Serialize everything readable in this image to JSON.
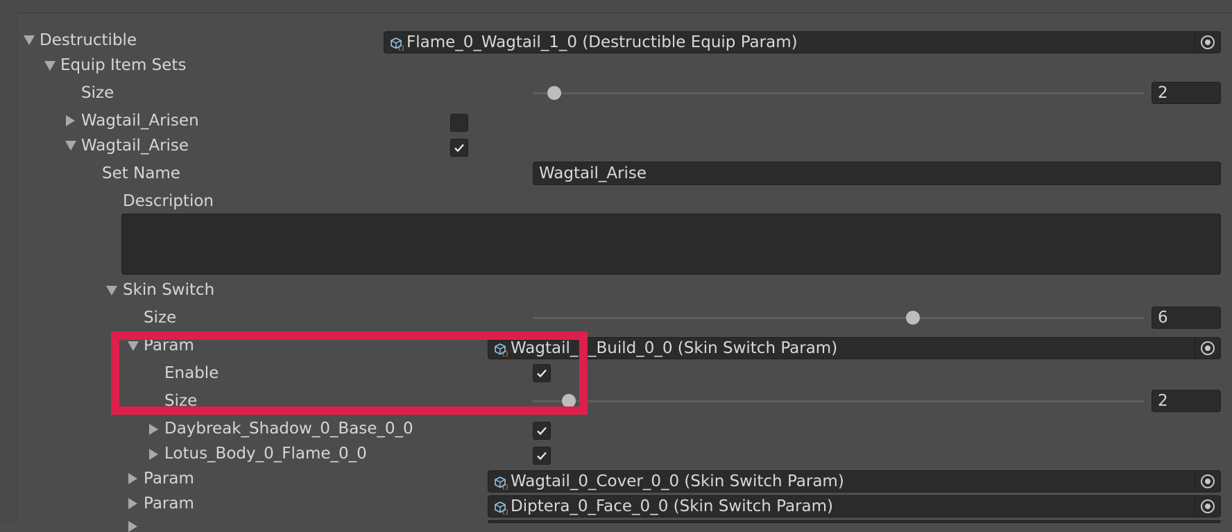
{
  "colors": {
    "highlight": "#dd1f4c",
    "field_bg": "#2b2b2b",
    "panel_bg": "#4c4c4c"
  },
  "tree": {
    "destructible": {
      "label": "Destructible",
      "object": "Flame_0_Wagtail_1_0 (Destructible Equip Param)"
    },
    "equip_item_sets": {
      "label": "Equip Item Sets",
      "size_label": "Size",
      "size_value": "2",
      "size_slider_fraction": 0.036
    },
    "wagtail_arisen": {
      "label": "Wagtail_Arisen",
      "checked": false
    },
    "wagtail_arise": {
      "label": "Wagtail_Arise",
      "checked": true,
      "set_name_label": "Set Name",
      "set_name_value": "Wagtail_Arise",
      "description_label": "Description",
      "description_value": ""
    },
    "skin_switch": {
      "label": "Skin Switch",
      "size_label": "Size",
      "size_value": "6",
      "size_slider_fraction": 0.62
    },
    "param_open": {
      "label": "Param",
      "object": "Wagtail_0_Build_0_0 (Skin Switch Param)",
      "enable_label": "Enable",
      "enable_checked": true,
      "size_label": "Size",
      "size_value": "2",
      "size_slider_fraction": 0.06
    },
    "daybreak": {
      "label": "Daybreak_Shadow_0_Base_0_0",
      "checked": true
    },
    "lotus": {
      "label": "Lotus_Body_0_Flame_0_0",
      "checked": true
    },
    "param_cover": {
      "label": "Param",
      "object": "Wagtail_0_Cover_0_0 (Skin Switch Param)"
    },
    "param_face": {
      "label": "Param",
      "object": "Diptera_0_Face_0_0 (Skin Switch Param)"
    },
    "param_partial": {
      "label": "Param"
    }
  },
  "icons": {
    "object": "script-cube-icon",
    "picker": "object-picker-icon",
    "check": "checkmark-icon"
  }
}
